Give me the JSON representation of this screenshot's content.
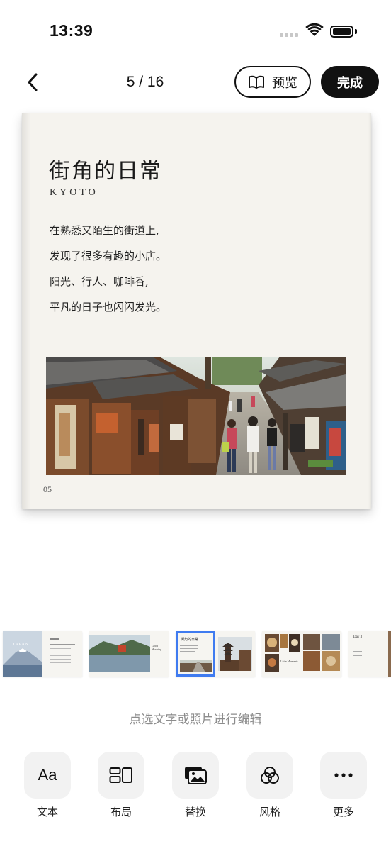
{
  "status": {
    "time": "13:39"
  },
  "nav": {
    "page_counter": "5 / 16",
    "preview_label": "预览",
    "done_label": "完成"
  },
  "page": {
    "title": "街角的日常",
    "subtitle": "KYOTO",
    "lines": [
      "在熟悉又陌生的街道上,",
      "发现了很多有趣的小店。",
      "阳光、行人、咖啡香,",
      "平凡的日子也闪闪发光。"
    ],
    "page_number": "05"
  },
  "thumbnails": {
    "t1": {
      "left_title": "JAPAN"
    },
    "t2": {
      "title": "Good Morning"
    },
    "t3": {
      "title": "街角的日常"
    },
    "t4": {
      "title": "Little Moments"
    },
    "t5": {
      "title": "Day 3"
    }
  },
  "hint": "点选文字或照片进行编辑",
  "tools": [
    {
      "icon": "text-icon",
      "glyph": "Aa",
      "label": "文本"
    },
    {
      "icon": "layout-icon",
      "label": "布局"
    },
    {
      "icon": "replace-image-icon",
      "label": "替换"
    },
    {
      "icon": "style-icon",
      "label": "风格"
    },
    {
      "icon": "more-icon",
      "label": "更多"
    }
  ],
  "colors": {
    "accent": "#3f7bf0",
    "primary": "#111111",
    "page_bg": "#f5f3ee",
    "hint": "#8c8c8c"
  }
}
